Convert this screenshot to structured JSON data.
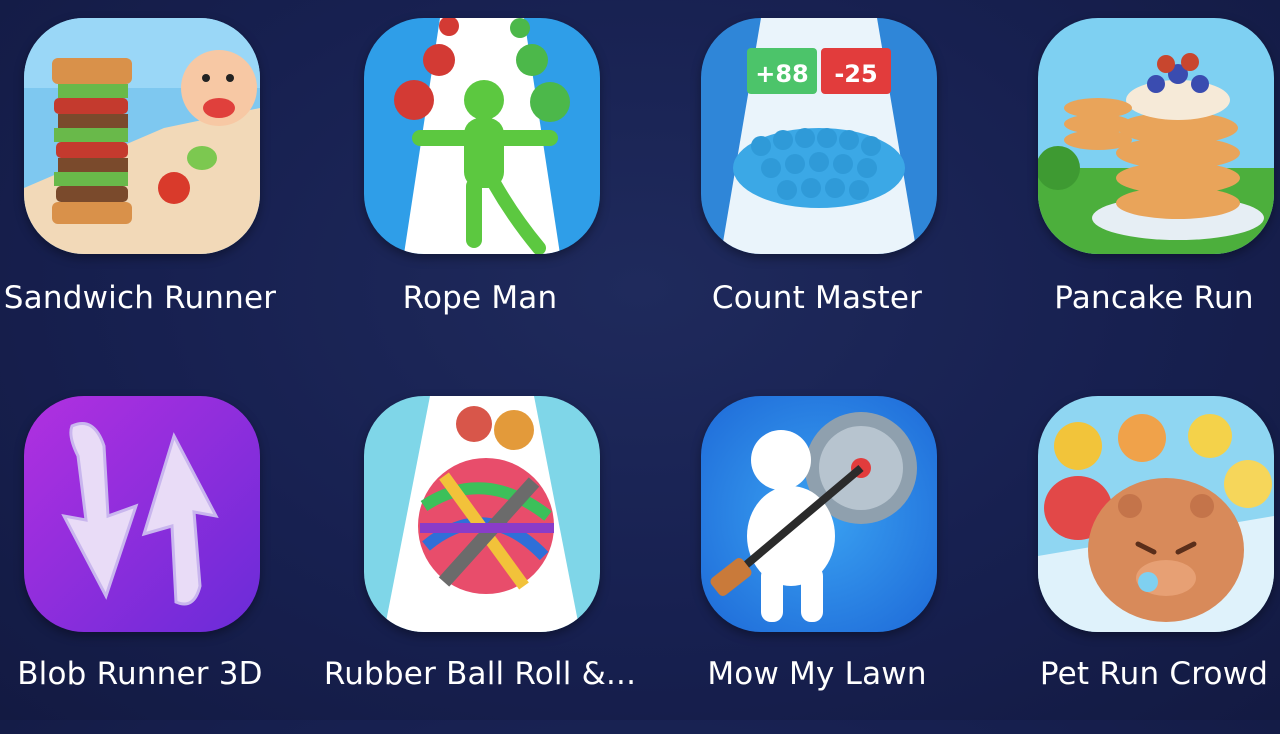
{
  "apps": [
    {
      "name": "Sandwich Runner",
      "icon": "sandwich-runner-icon"
    },
    {
      "name": "Rope Man",
      "icon": "rope-man-icon"
    },
    {
      "name": "Count Master",
      "icon": "count-master-icon",
      "gates": [
        "+88",
        "-25"
      ]
    },
    {
      "name": "Pancake Run",
      "icon": "pancake-run-icon"
    },
    {
      "name": "Blob Runner 3D",
      "icon": "blob-runner-3d-icon"
    },
    {
      "name": "Rubber Ball Roll &...",
      "icon": "rubber-ball-roll-icon"
    },
    {
      "name": "Mow My Lawn",
      "icon": "mow-my-lawn-icon"
    },
    {
      "name": "Pet Run Crowd",
      "icon": "pet-run-crowd-icon"
    }
  ]
}
